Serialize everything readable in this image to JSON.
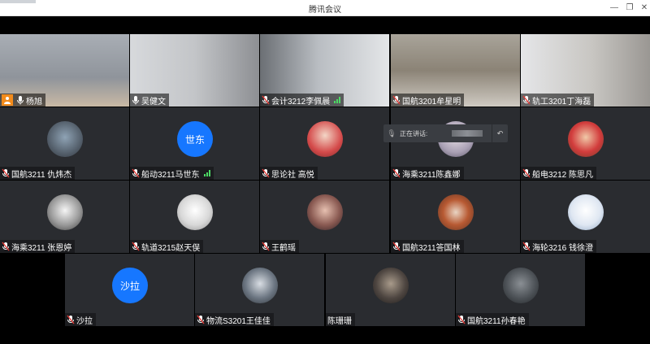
{
  "window": {
    "title": "腾讯会议",
    "minimize_label": "—",
    "restore_label": "❐",
    "close_label": "✕"
  },
  "speaking_indicator": {
    "label": "正在讲话:"
  },
  "colors": {
    "avatar_blue": "#1677ff",
    "host_badge": "#f28b1b",
    "tile_bg": "#2a2c30",
    "signal_green": "#4cd964"
  },
  "participants": [
    {
      "name": "杨旭",
      "video": true,
      "host": true,
      "mic": "on"
    },
    {
      "name": "吴健文",
      "video": true,
      "mic": "on"
    },
    {
      "name": "会计3212李佩晨",
      "video": true,
      "mic": "muted",
      "signal": true
    },
    {
      "name": "国航3201牟星明",
      "video": true,
      "mic": "muted"
    },
    {
      "name": "轨工3201丁海磊",
      "video": true,
      "mic": "muted"
    },
    {
      "name": "国航3211 仇炜杰",
      "video": false,
      "mic": "muted",
      "avatar": "photo"
    },
    {
      "name": "船动3211马世东",
      "video": false,
      "mic": "muted",
      "avatar_text": "世东",
      "signal": true
    },
    {
      "name": "思论社 高悦",
      "video": false,
      "mic": "muted",
      "avatar": "photo"
    },
    {
      "name": "海乘3211陈鑫娜",
      "video": false,
      "mic": "muted",
      "avatar": "photo"
    },
    {
      "name": "船电3212 陈思凡",
      "video": false,
      "mic": "muted",
      "avatar": "photo"
    },
    {
      "name": "海乘3211 张恩婷",
      "video": false,
      "mic": "muted",
      "avatar": "photo"
    },
    {
      "name": "轨道3215赵天俣",
      "video": false,
      "mic": "muted",
      "avatar": "photo"
    },
    {
      "name": "王鹤瑶",
      "video": false,
      "mic": "muted",
      "avatar": "photo"
    },
    {
      "name": "国航3211答国林",
      "video": false,
      "mic": "muted",
      "avatar": "photo"
    },
    {
      "name": "海轮3216 钱徐澄",
      "video": false,
      "mic": "muted",
      "avatar": "photo"
    },
    {
      "name": "沙拉",
      "video": false,
      "mic": "muted",
      "avatar_text": "沙拉"
    },
    {
      "name": "物流S3201王佳佳",
      "video": false,
      "mic": "muted",
      "avatar": "photo"
    },
    {
      "name": "陈珊珊",
      "video": false,
      "mic": "none",
      "avatar": "photo"
    },
    {
      "name": "国航3211孙春艳",
      "video": false,
      "mic": "muted",
      "avatar": "photo"
    }
  ]
}
